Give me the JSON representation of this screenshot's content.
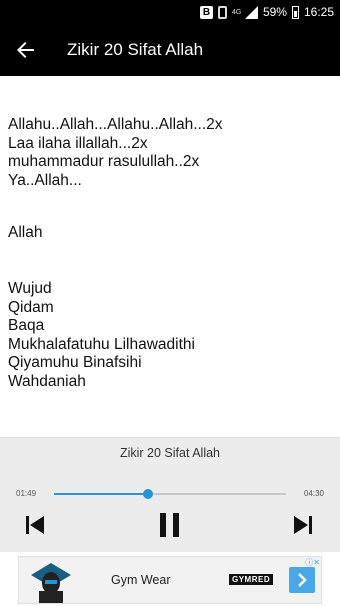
{
  "status_bar": {
    "notification_icon": "b-icon",
    "network": "4G",
    "battery": "59%",
    "time": "16:25"
  },
  "app_bar": {
    "title": "Zikir 20 Sifat Allah",
    "back_icon": "arrow-left-icon"
  },
  "content": {
    "block1": [
      "Allahu..Allah...Allahu..Allah...2x",
      "Laa ilaha illallah...2x",
      "muhammadur rasulullah..2x",
      "Ya..Allah..."
    ],
    "block2": "Allah",
    "block3": [
      "Wujud",
      "Qidam",
      "Baqa",
      "Mukhalafatuhu Lilhawadithi",
      "Qiyamuhu Binafsihi",
      "Wahdaniah"
    ]
  },
  "player": {
    "track_title": "Zikir 20 Sifat Allah",
    "current_time": "01:49",
    "duration": "04:30",
    "progress_fraction": 0.405,
    "accent_color": "#2a93d5",
    "prev_icon": "skip-previous-icon",
    "pause_icon": "pause-icon",
    "next_icon": "skip-next-icon"
  },
  "ad": {
    "text": "Gym Wear",
    "brand": "GYMRED",
    "arrow_icon": "chevron-right-icon"
  }
}
